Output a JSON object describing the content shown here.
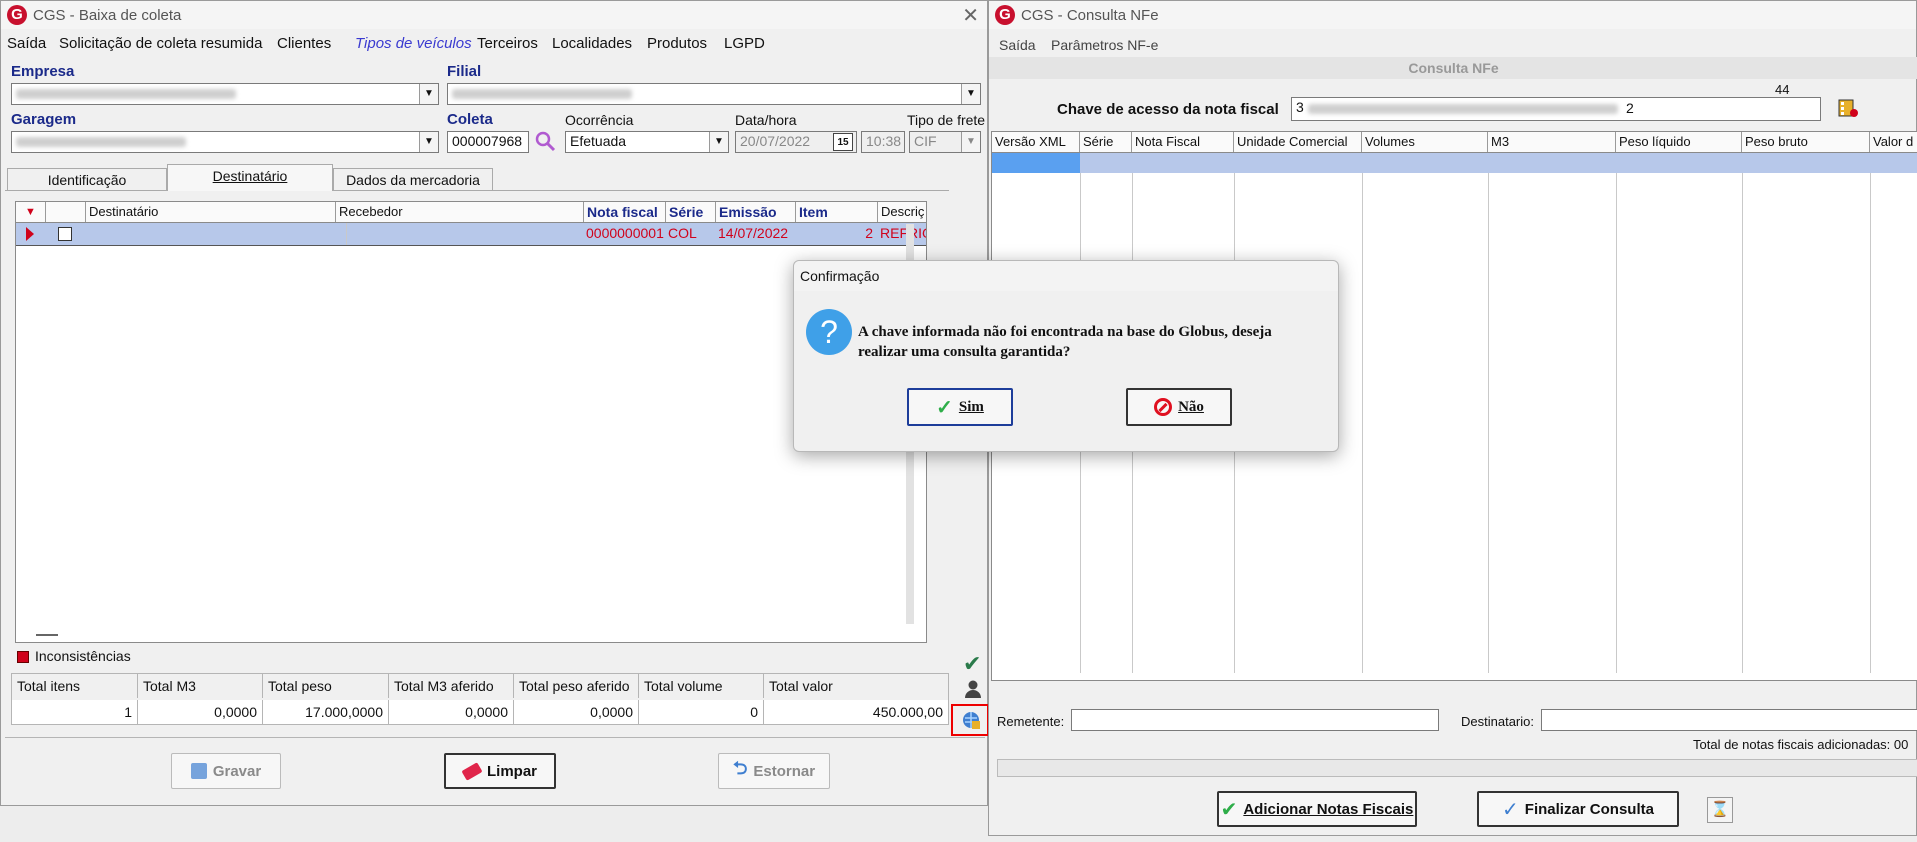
{
  "left_window": {
    "title": "CGS - Baixa de coleta",
    "menu": [
      "Saída",
      "Solicitação de coleta resumida",
      "Clientes",
      "Tipos de veículos",
      "Terceiros",
      "Localidades",
      "Produtos",
      "LGPD"
    ],
    "labels": {
      "empresa": "Empresa",
      "filial": "Filial",
      "garagem": "Garagem",
      "coleta": "Coleta",
      "ocorrencia": "Ocorrência",
      "datahora": "Data/hora",
      "tipo_frete": "Tipo de frete"
    },
    "values": {
      "coleta": "000007968",
      "ocorrencia": "Efetuada",
      "data": "20/07/2022",
      "calendar_day": "15",
      "hora": "10:38",
      "tipo_frete": "CIF"
    },
    "tabs": [
      "Identificação",
      "Destinatário",
      "Dados da mercadoria"
    ],
    "grid_headers": [
      "Destinatário",
      "Recebedor",
      "Nota fiscal",
      "Série",
      "Emissão",
      "Item",
      "Descriç"
    ],
    "grid_row": {
      "nota_fiscal": "0000000001",
      "serie": "COL",
      "emissao": "14/07/2022",
      "item": "2",
      "descricao": "REFRIG"
    },
    "inconsistencias": "Inconsistências",
    "totals_headers": [
      "Total itens",
      "Total M3",
      "Total peso",
      "Total M3 aferido",
      "Total peso aferido",
      "Total volume",
      "Total valor"
    ],
    "totals_values": [
      "1",
      "0,0000",
      "17.000,0000",
      "0,0000",
      "0,0000",
      "0",
      "450.000,00"
    ],
    "buttons": {
      "gravar": "Gravar",
      "limpar": "Limpar",
      "estornar": "Estornar"
    }
  },
  "right_window": {
    "title": "CGS - Consulta NFe",
    "menu": [
      "Saída",
      "Parâmetros NF-e"
    ],
    "section_title": "Consulta NFe",
    "chave_label": "Chave de acesso da nota fiscal",
    "chave_count": "44",
    "chave_start": "3",
    "chave_end": "2",
    "grid_headers": [
      "Versão XML",
      "Série",
      "Nota Fiscal",
      "Unidade Comercial",
      "Volumes",
      "M3",
      "Peso líquido",
      "Peso bruto",
      "Valor d"
    ],
    "remetente_label": "Remetente:",
    "destinatario_label": "Destinatario:",
    "total_notas": "Total de notas fiscais adicionadas: 00",
    "buttons": {
      "adicionar": "Adicionar Notas Fiscais",
      "finalizar": "Finalizar Consulta"
    }
  },
  "dialog": {
    "title": "Confirmação",
    "message_line1": "A chave informada não foi encontrada na base do Globus, deseja",
    "message_line2": "realizar uma consulta garantida?",
    "yes": "Sim",
    "no": "Não"
  },
  "colors": {
    "selection": "#b7c8ea",
    "red_text": "#d0021b",
    "label_blue": "#1b2a8a",
    "logo_red": "#c8102e"
  }
}
